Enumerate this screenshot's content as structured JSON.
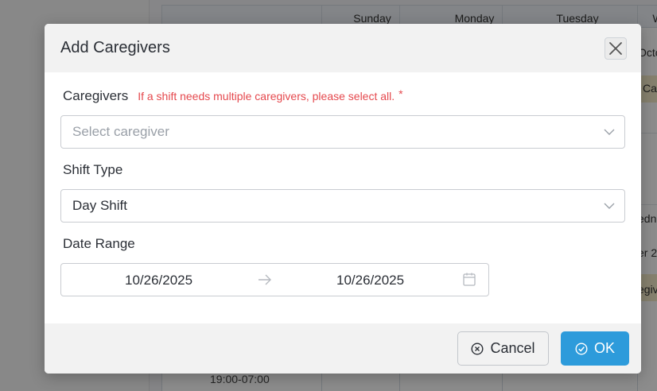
{
  "background": {
    "days": [
      "Sunday",
      "Monday",
      "Tuesday",
      "W"
    ],
    "fragments": [
      "Octo",
      "Ca",
      "edne",
      "er 2",
      "egiv"
    ],
    "time_slot": "19:00-07:00"
  },
  "modal": {
    "title": "Add Caregivers",
    "close_icon": "close-icon",
    "caregivers": {
      "label": "Caregivers",
      "hint": "If a shift needs multiple caregivers, please select all.",
      "required_mark": "*",
      "placeholder": "Select caregiver"
    },
    "shift_type": {
      "label": "Shift Type",
      "value": "Day Shift"
    },
    "date_range": {
      "label": "Date Range",
      "start": "10/26/2025",
      "end": "10/26/2025"
    },
    "footer": {
      "cancel_label": "Cancel",
      "ok_label": "OK"
    }
  },
  "colors": {
    "primary": "#2d9bdb",
    "required": "#e5484d",
    "overlay": "rgba(0,0,0,0.45)"
  }
}
